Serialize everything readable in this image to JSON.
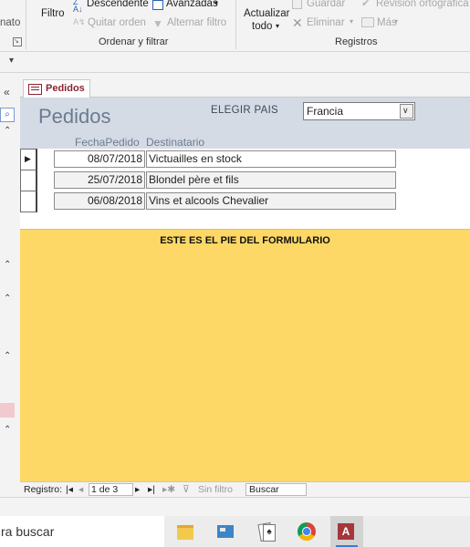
{
  "ribbon": {
    "frag_label": "nato",
    "filtro_label": "Filtro",
    "descendente_label": "Descendente",
    "quitar_orden_label": "Quitar orden",
    "avanzadas_label": "Avanzadas",
    "alternar_filtro_label": "Alternar filtro",
    "ordenar_group_label": "Ordenar y filtrar",
    "actualizar_label": "Actualizar",
    "todo_label": "todo",
    "guardar_label": "Guardar",
    "eliminar_label": "Eliminar",
    "revision_label": "Revisión ortográfica",
    "mas_label": "Más",
    "registros_group_label": "Registros"
  },
  "tab": {
    "label": "Pedidos"
  },
  "form": {
    "title": "Pedidos",
    "country_label": "ELEGIR PAIS",
    "country_value": "Francia",
    "col_fecha": "FechaPedido",
    "col_destinatario": "Destinatario",
    "rows": [
      {
        "fecha": "08/07/2018",
        "destinatario": "Victuailles en stock"
      },
      {
        "fecha": "25/07/2018",
        "destinatario": "Blondel père et fils"
      },
      {
        "fecha": "06/08/2018",
        "destinatario": "Vins et alcools Chevalier"
      }
    ],
    "footer_text": "ESTE ES EL PIE DEL FORMULARIO"
  },
  "navbar": {
    "registro_label": "Registro:",
    "record_value": "1 de 3",
    "sin_filtro_label": "Sin filtro",
    "buscar_value": "Buscar"
  },
  "taskbar": {
    "search_fragment": "ra buscar"
  },
  "colors": {
    "footer": "#fdd866",
    "header": "#d5dbe5",
    "tab_text": "#8a2431"
  }
}
